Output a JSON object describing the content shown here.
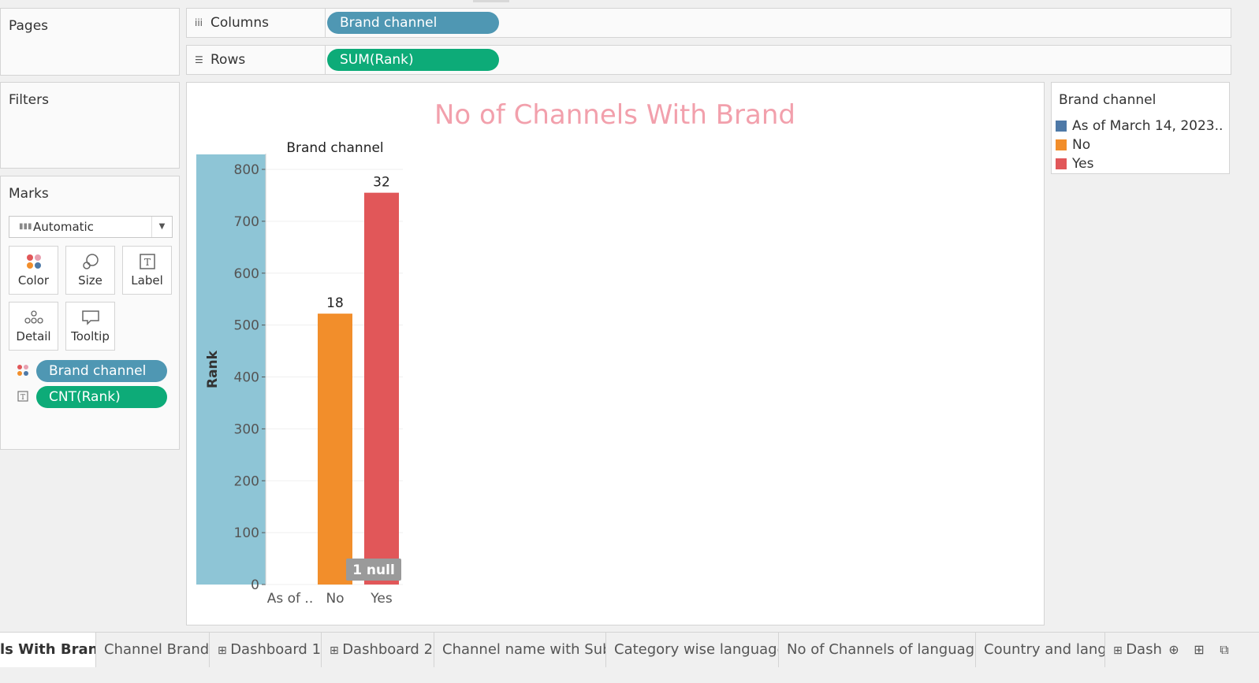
{
  "pages": {
    "title": "Pages"
  },
  "filters": {
    "title": "Filters"
  },
  "shelves": {
    "columns": {
      "label": "Columns",
      "icon": "columns-icon",
      "pill": "Brand channel"
    },
    "rows": {
      "label": "Rows",
      "icon": "rows-icon",
      "pill": "SUM(Rank)"
    }
  },
  "marks": {
    "title": "Marks",
    "type": "Automatic",
    "buttons": [
      {
        "label": "Color",
        "icon": "color-icon"
      },
      {
        "label": "Size",
        "icon": "size-icon"
      },
      {
        "label": "Label",
        "icon": "label-icon"
      },
      {
        "label": "Detail",
        "icon": "detail-icon"
      },
      {
        "label": "Tooltip",
        "icon": "tooltip-icon"
      }
    ],
    "pills": [
      {
        "label": "Brand channel",
        "icon": "color-icon",
        "color": "#4f97b3"
      },
      {
        "label": "CNT(Rank)",
        "icon": "label-icon",
        "color": "#0dab78"
      }
    ]
  },
  "chart_data": {
    "type": "bar",
    "title": "No of Channels With Brand",
    "column_header": "Brand channel",
    "ylabel": "Rank",
    "ylim": [
      0,
      800
    ],
    "yticks": [
      0,
      100,
      200,
      300,
      400,
      500,
      600,
      700,
      800
    ],
    "categories": [
      "As of ..",
      "No",
      "Yes"
    ],
    "values": [
      null,
      522,
      755
    ],
    "labels": [
      "",
      "18",
      "32"
    ],
    "colors": [
      "#4e79a7",
      "#f28e2b",
      "#e15759"
    ],
    "null_indicator": "1 null",
    "grid": true
  },
  "legend": {
    "title": "Brand channel",
    "items": [
      {
        "label": "As of March 14, 2023..",
        "color": "#4e79a7"
      },
      {
        "label": "No",
        "color": "#f28e2b"
      },
      {
        "label": "Yes",
        "color": "#e15759"
      }
    ]
  },
  "tabs": [
    {
      "label": "ls With Brand",
      "active": true
    },
    {
      "label": "Channel Brand"
    },
    {
      "label": "Dashboard 1",
      "icon": "dashboard-icon"
    },
    {
      "label": "Dashboard 2",
      "icon": "dashboard-icon"
    },
    {
      "label": "Channel name with Sub"
    },
    {
      "label": "Category wise language"
    },
    {
      "label": "No of Channels of language"
    },
    {
      "label": "Country and lang"
    },
    {
      "label": "Dashl",
      "icon": "dashboard-icon"
    }
  ]
}
